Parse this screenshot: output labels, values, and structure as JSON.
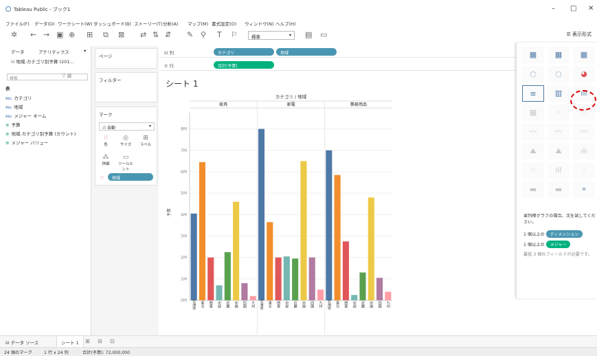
{
  "window": {
    "title": "Tableau Public - ブック1",
    "minimize": "–",
    "maximize": "□",
    "close": "✕"
  },
  "menu": [
    "ファイル(F)",
    "データ(D)",
    "ワークシート(W)",
    "ダッシュボード(B)",
    "ストーリー(T)",
    "分析(A)",
    "マップ(M)",
    "書式設定(O)",
    "ウィンドウ(N)",
    "ヘルプ(H)"
  ],
  "toolbar": {
    "fit": "標準",
    "show_me": "表示形式"
  },
  "left_panel": {
    "tab_data": "データ",
    "tab_analytics": "アナリティクス",
    "datasource": "地域-カテゴリ別予算 (201…",
    "search_placeholder": "検索",
    "section_table": "表",
    "dimensions": [
      "カテゴリ",
      "地域",
      "メジャー ネーム"
    ],
    "measures": [
      "予算",
      "地域-カテゴリ別予算 (カウント)",
      "メジャー バリュー"
    ],
    "dim_badge": "Abc"
  },
  "middle_panel": {
    "pages": "ページ",
    "filters": "フィルター",
    "marks": "マーク",
    "mark_type": "自動",
    "mark_buttons": [
      "色",
      "サイズ",
      "ラベル",
      "詳細",
      "ツールヒント"
    ],
    "color_pill": "地域"
  },
  "shelves": {
    "columns_label": "列",
    "rows_label": "行",
    "columns_pills": [
      "カテゴリ",
      "地域"
    ],
    "rows_pills": [
      "合計(予算)"
    ]
  },
  "sheet": {
    "title": "シート 1"
  },
  "chart_data": {
    "type": "bar",
    "header": "カテゴリ / 地域",
    "ylabel": "予算",
    "ylim": [
      0,
      8500000
    ],
    "yticks": [
      "0M",
      "1M",
      "2M",
      "3M",
      "4M",
      "5M",
      "6M",
      "7M",
      "8M"
    ],
    "groups": [
      {
        "name": "家具",
        "values": [
          4050000,
          6450000,
          2000000,
          700000,
          2250000,
          4600000,
          800000,
          200000
        ]
      },
      {
        "name": "家電",
        "values": [
          8000000,
          3650000,
          2000000,
          2050000,
          1950000,
          6500000,
          2000000,
          500000
        ]
      },
      {
        "name": "事務用品",
        "values": [
          7000000,
          5850000,
          2750000,
          250000,
          1300000,
          4800000,
          1050000,
          400000
        ]
      }
    ],
    "regions": [
      "北海道",
      "東北",
      "関東",
      "中部",
      "近畿",
      "中国",
      "四国",
      "九州"
    ],
    "colors": [
      "#4e79a7",
      "#f28e2b",
      "#e15759",
      "#76b7b2",
      "#59a14f",
      "#edc948",
      "#b07aa1",
      "#ff9da7"
    ]
  },
  "show_me": {
    "hint": "並列棒グラフの場合、次を試してください。",
    "req1_prefix": "1 個以上の",
    "req1_pill": "ディメンション",
    "req2_prefix": "1 個以上の",
    "req2_pill": "メジャー",
    "req3": "最低 3 個のフィールドが必要です。"
  },
  "bottom_tabs": {
    "datasource": "データ ソース",
    "sheet": "シート 1"
  },
  "status": {
    "marks": "24 個のマーク",
    "dims": "1 行 x 24 列",
    "sum": "合計(予算): 72,000,000"
  }
}
